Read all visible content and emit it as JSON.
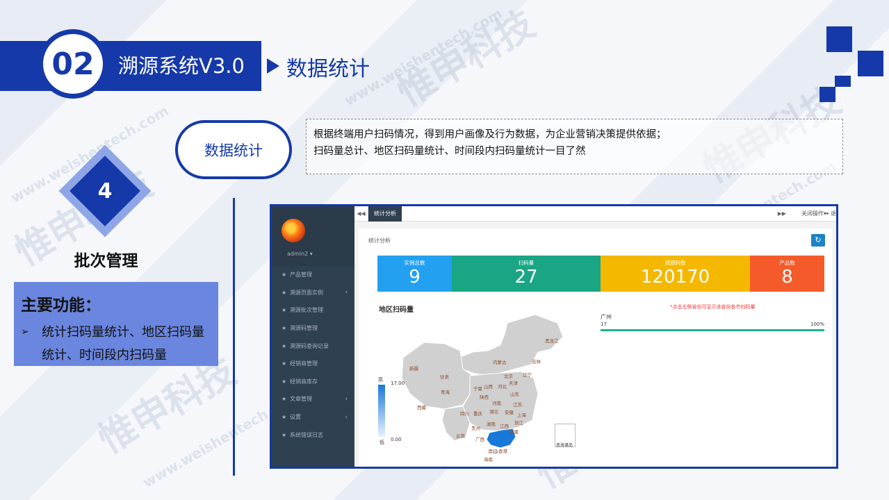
{
  "header": {
    "number": "02",
    "title": "溯源系统V3.0",
    "subtitle": "数据统计"
  },
  "module": {
    "number": "4",
    "name": "批次管理",
    "features_title": "主要功能：",
    "feature_bullet": "➢",
    "feature_lines": [
      "统计扫码量统计、地区扫码量",
      "统计、时间段内扫码量"
    ]
  },
  "section": {
    "pill_label": "数据统计",
    "description_lines": [
      "根据终端用户扫码情况，得到用户画像及行为数据，为企业营销决策提供依据；",
      "扫码量总计、地区扫码量统计、时间段内扫码量统计一目了然"
    ]
  },
  "watermark": {
    "text": "惟申科技",
    "url": "www.weishentech.com"
  },
  "app": {
    "user": "admin2 ▾",
    "menu": [
      {
        "label": "产品管理",
        "has_children": false
      },
      {
        "label": "溯源页面实例",
        "has_children": true
      },
      {
        "label": "溯源批次管理",
        "has_children": false
      },
      {
        "label": "溯源码管理",
        "has_children": false
      },
      {
        "label": "溯源码查询记录",
        "has_children": false
      },
      {
        "label": "经销商管理",
        "has_children": false
      },
      {
        "label": "经销商库存",
        "has_children": false
      },
      {
        "label": "文章管理",
        "has_children": true
      },
      {
        "label": "设置",
        "has_children": true
      },
      {
        "label": "系统错误日志",
        "has_children": false
      }
    ],
    "menu_star": "★",
    "menu_caret": "‹",
    "tabs": {
      "back": "◀◀",
      "active": "统计分析",
      "forward": "▶▶",
      "close_ops": "关闭操作▾",
      "exit": "⇥ 退"
    },
    "panel_title": "统计分析",
    "refresh_icon": "↻",
    "stats": [
      {
        "label": "实例总数",
        "value": "9",
        "color": "#23a0f0"
      },
      {
        "label": "扫码量",
        "value": "27",
        "color": "#1aa584"
      },
      {
        "label": "溯源码数",
        "value": "120170",
        "color": "#f5b800"
      },
      {
        "label": "产品数",
        "value": "8",
        "color": "#f55a2a"
      }
    ],
    "region_title": "地区扫码量",
    "region_note": "*点击左侧省份可显示该省份各市扫码量",
    "legend": {
      "high": "高",
      "low": "低",
      "max": "17.00",
      "min": "0.00"
    },
    "south_sea_label": "南海诸岛",
    "ranking": [
      {
        "name": "广州",
        "count": "17",
        "percent": "100%",
        "fraction": 1.0
      }
    ],
    "map_labels": {
      "heilongjiang": "黑龙江",
      "jilin": "吉林",
      "liaoning": "辽宁",
      "neimenggu": "内蒙古",
      "beijing": "北京",
      "tianjin": "天津",
      "hebei": "河北",
      "shanxi": "山西",
      "shandong": "山东",
      "xinjiang": "新疆",
      "gansu": "甘肃",
      "ningxia": "宁夏",
      "shaanxi": "陕西",
      "henan": "河南",
      "jiangsu": "江苏",
      "qinghai": "青海",
      "xizang": "西藏",
      "sichuan": "四川",
      "chongqing": "重庆",
      "hubei": "湖北",
      "anhui": "安徽",
      "shanghai": "上海",
      "zhejiang": "浙江",
      "hunan": "湖南",
      "jiangxi": "江西",
      "guizhou": "贵州",
      "yunnan": "云南",
      "guangxi": "广西",
      "fujian": "福建",
      "aomen": "澳门",
      "xianggang": "香港",
      "hainan": "海南"
    },
    "colors": {
      "sidebar": "#2f4050",
      "map_default": "#d0d0d0",
      "map_highlight": "#1a78d8",
      "ranking_bar": "#1ab394"
    }
  },
  "colors": {
    "brand_blue": "#1539a8",
    "feature_box": "#6a86de"
  }
}
